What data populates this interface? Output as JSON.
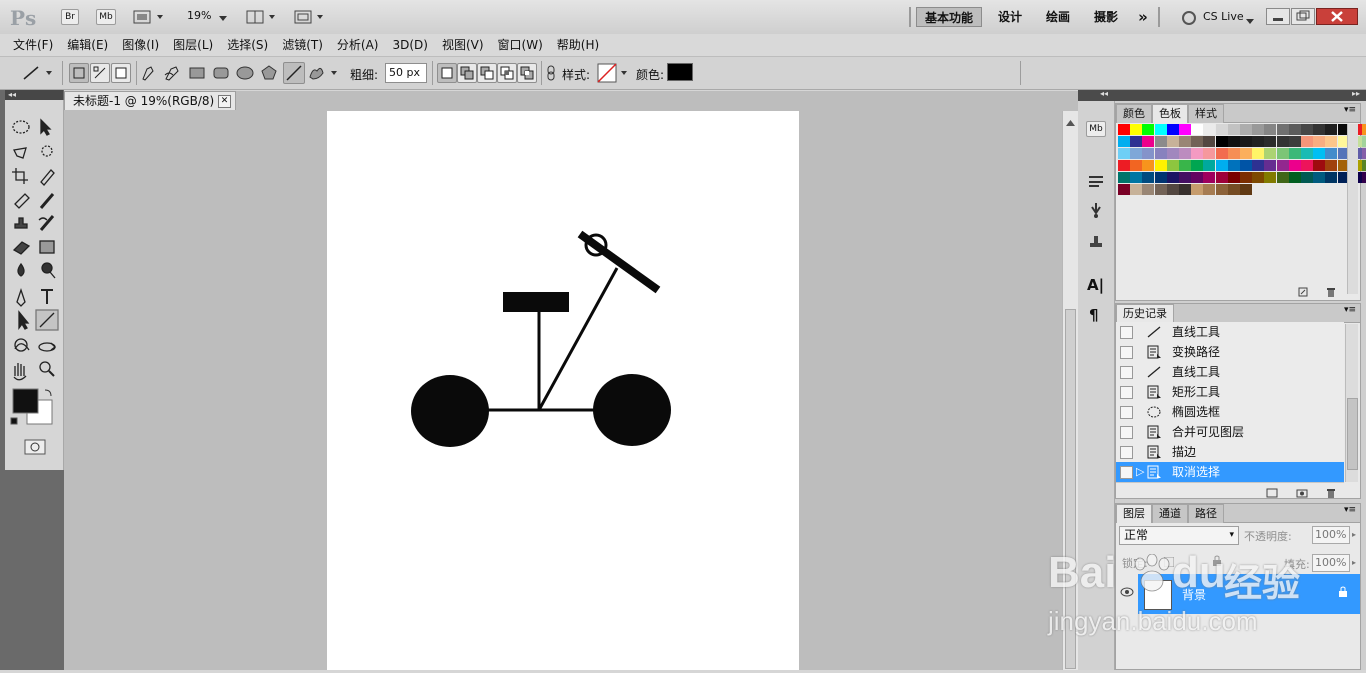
{
  "app": {
    "logo": "Ps",
    "bridge_btn": "Br",
    "minibridge_btn": "Mb",
    "zoom": "19%",
    "workspaces": [
      "基本功能",
      "设计",
      "绘画",
      "摄影"
    ],
    "more_workspaces": "»",
    "cs_live": "CS Live"
  },
  "menu": [
    "文件(F)",
    "编辑(E)",
    "图像(I)",
    "图层(L)",
    "选择(S)",
    "滤镜(T)",
    "分析(A)",
    "3D(D)",
    "视图(V)",
    "窗口(W)",
    "帮助(H)"
  ],
  "options": {
    "weight_label": "粗细:",
    "weight_value": "50 px",
    "style_label": "样式:",
    "color_label": "颜色:",
    "color_value": "#000000"
  },
  "document": {
    "tab_title": "未标题-1 @ 19%(RGB/8) *"
  },
  "panels": {
    "color_tabs": [
      "颜色",
      "色板",
      "样式"
    ],
    "active_color_tab": "色板",
    "history_tab": "历史记录",
    "layers_tabs": [
      "图层",
      "通道",
      "路径"
    ],
    "blend_mode": "正常",
    "opacity_label": "不透明度:",
    "opacity_value": "100%",
    "fill_label": "填充:",
    "fill_value": "100%",
    "lock_label": "锁定:",
    "layer_name": "背景"
  },
  "history": [
    {
      "label": "直线工具",
      "icon": "line-icon"
    },
    {
      "label": "变换路径",
      "icon": "doc-icon"
    },
    {
      "label": "直线工具",
      "icon": "line-icon"
    },
    {
      "label": "矩形工具",
      "icon": "doc-icon"
    },
    {
      "label": "椭圆选框",
      "icon": "ellipse-icon"
    },
    {
      "label": "合并可见图层",
      "icon": "doc-icon"
    },
    {
      "label": "描边",
      "icon": "doc-icon"
    },
    {
      "label": "取消选择",
      "icon": "doc-icon",
      "selected": true
    }
  ],
  "watermark": {
    "brand": "Bai",
    "brand2": "du",
    "product": "经验",
    "url": "jingyan.baidu.com"
  },
  "colors": {
    "accent": "#3399ff",
    "foreground": "#000000",
    "background": "#ffffff"
  }
}
